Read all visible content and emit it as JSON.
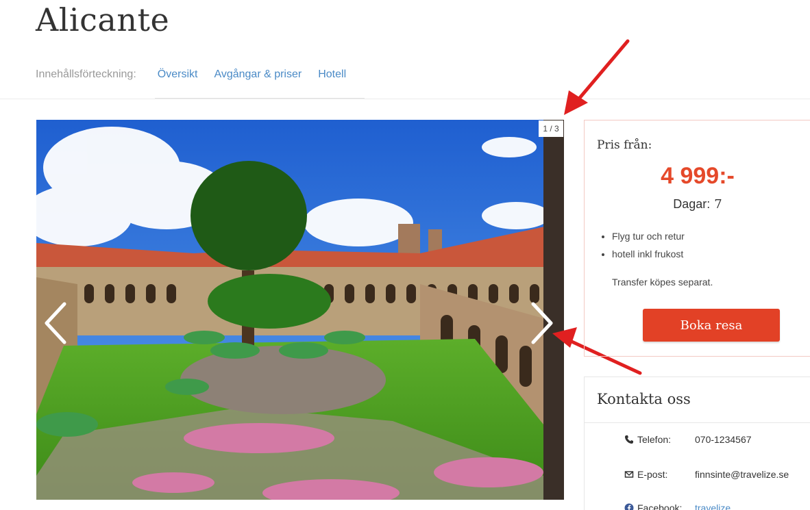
{
  "page": {
    "title": "Alicante"
  },
  "toc": {
    "label": "Innehållsförteckning:",
    "links": [
      "Översikt",
      "Avgångar & priser",
      "Hotell"
    ]
  },
  "gallery": {
    "counter": "1 / 3",
    "prev_icon": "chevron-left-icon",
    "next_icon": "chevron-right-icon"
  },
  "price": {
    "label": "Pris från:",
    "value": "4 999:-",
    "days_label": "Dagar:",
    "days_value": "7",
    "features": [
      "Flyg tur och retur",
      "hotell inkl frukost"
    ],
    "transfer_note": "Transfer köpes separat.",
    "book_label": "Boka resa"
  },
  "contact": {
    "title": "Kontakta oss",
    "phone_label": "Telefon:",
    "phone_value": "070-1234567",
    "email_label": "E-post:",
    "email_value": "finnsinte@travelize.se",
    "facebook_label": "Facebook:",
    "facebook_value": "travelize"
  },
  "colors": {
    "accent": "#e5492a",
    "button": "#e24126",
    "link": "#4a8ac6",
    "annotation": "#e02020"
  }
}
